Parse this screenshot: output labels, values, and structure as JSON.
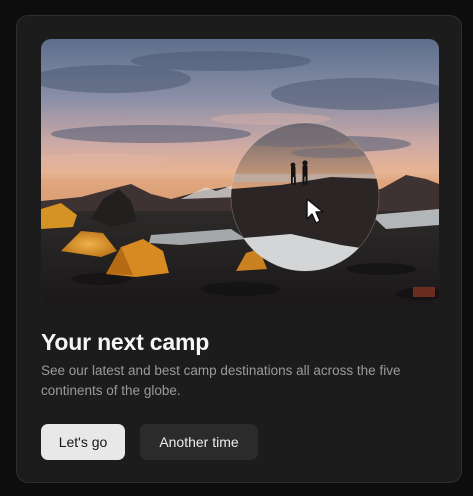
{
  "card": {
    "title": "Your next camp",
    "description": "See our latest and best camp destinations all across the five continents of the globe.",
    "primary_button": "Let's go",
    "secondary_button": "Another time"
  },
  "colors": {
    "page_background": "#0d0d0d",
    "card_background": "#1c1c1c",
    "primary_button_bg": "#e8e8e8",
    "secondary_button_bg": "#2b2b2b"
  },
  "icons": {
    "cursor": "cursor-arrow-icon"
  }
}
